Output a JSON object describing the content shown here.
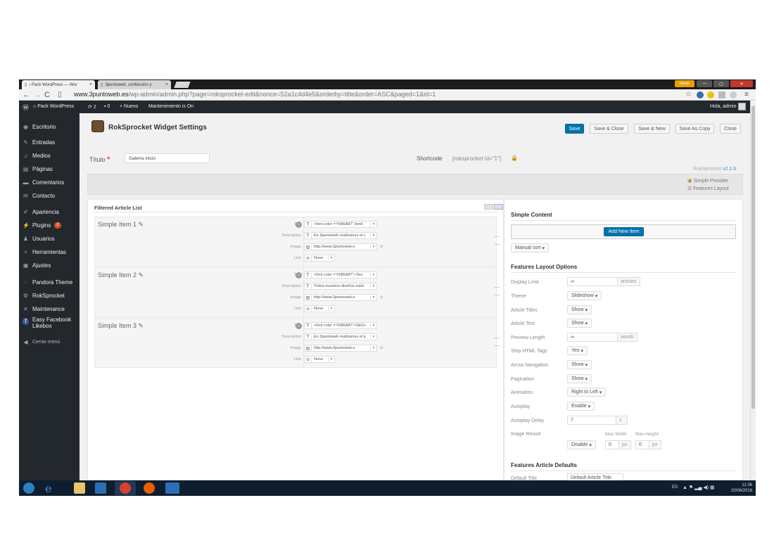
{
  "browser": {
    "tabs": [
      {
        "title": "‹ Pack WordPress — Wor"
      },
      {
        "title": "3puntoweb, confección y"
      }
    ],
    "window_user": "cesar",
    "url_domain": "www.3puntoweb.es",
    "url_path": "/wp-admin/admin.php?page=roksprocket-edit&nonce=52a1c4d4e5&orderby=title&order=ASC&paged=1&id=1"
  },
  "adminbar": {
    "site": "Pack WordPress",
    "updates": "2",
    "comments": "0",
    "new": "Nuevo",
    "maintenance": "Mantenimiento is On",
    "greeting": "Hola, admin"
  },
  "sidebar": {
    "items": [
      {
        "label": "Escritorio",
        "icon": "dashboard-icon"
      },
      {
        "label": "Entradas",
        "icon": "pin-icon"
      },
      {
        "label": "Medios",
        "icon": "media-icon"
      },
      {
        "label": "Páginas",
        "icon": "pages-icon"
      },
      {
        "label": "Comentarios",
        "icon": "comments-icon"
      },
      {
        "label": "Contacto",
        "icon": "mail-icon"
      },
      {
        "label": "Apariencia",
        "icon": "brush-icon"
      },
      {
        "label": "Plugins",
        "icon": "plugin-icon",
        "badge": "2"
      },
      {
        "label": "Usuarios",
        "icon": "users-icon"
      },
      {
        "label": "Herramientas",
        "icon": "wrench-icon"
      },
      {
        "label": "Ajustes",
        "icon": "settings-icon"
      },
      {
        "label": "Pandora Theme",
        "icon": "theme-icon"
      },
      {
        "label": "RokSprocket",
        "icon": "rocket-icon"
      },
      {
        "label": "Maintenance",
        "icon": "tools-icon"
      },
      {
        "label": "Easy Facebook Likebox",
        "icon": "facebook-icon"
      },
      {
        "label": "Cerrar menú",
        "icon": "collapse-icon"
      }
    ]
  },
  "header": {
    "title": "RokSprocket Widget Settings",
    "buttons": {
      "save": "Save",
      "save_close": "Save & Close",
      "save_new": "Save & New",
      "save_copy": "Save As Copy",
      "close": "Close"
    }
  },
  "form": {
    "title_label": "Título",
    "required_mark": "*",
    "title_value": "Galería inicio",
    "shortcode_label": "Shortcode",
    "shortcode_value": "[roksprocket id=\"1\"]",
    "version_prefix": "RokSprocket",
    "version": "v2.1.6",
    "provider": "Simple Provider",
    "layout": "Features Layout"
  },
  "filtered": {
    "heading": "Filtered Article List",
    "field_labels": {
      "title": "Title",
      "description": "Description",
      "image": "Image",
      "link": "Link"
    },
    "items": [
      {
        "name": "Simple Item 1",
        "title": "<font color =\"#086A87\" famil",
        "description": "En 3puntoweb realizamos el c",
        "image": "http://www.3puntoweb.e",
        "link": "None"
      },
      {
        "name": "Simple Item 2",
        "title": "<font color =\"#086A87\">Tecr",
        "description": "Todos nuestros diseños estár",
        "image": "http://www.3puntoweb.e",
        "link": "None"
      },
      {
        "name": "Simple Item 3",
        "title": "<font color =\"#086A87\">SEO<",
        "description": "En 3puntoweb realizamos el p",
        "image": "http://www.3puntoweb.e",
        "link": "None"
      }
    ]
  },
  "simple_content": {
    "heading": "Simple Content",
    "add_button": "Add New Item",
    "sort": "Manual sort"
  },
  "layout_options": {
    "heading": "Features Layout Options",
    "display_limit": {
      "label": "Display Limit",
      "value": "∞",
      "unit": "articles"
    },
    "theme": {
      "label": "Theme",
      "value": "Slideshow"
    },
    "article_titles": {
      "label": "Article Titles",
      "value": "Show"
    },
    "article_text": {
      "label": "Article Text",
      "value": "Show"
    },
    "preview_length": {
      "label": "Preview Length",
      "value": "∞",
      "unit": "words"
    },
    "strip_html": {
      "label": "Strip HTML Tags",
      "value": "Yes"
    },
    "arrow_nav": {
      "label": "Arrow Navigation",
      "value": "Show"
    },
    "pagination": {
      "label": "Pagination",
      "value": "Show"
    },
    "animation": {
      "label": "Animation",
      "value": "Right to Left"
    },
    "autoplay": {
      "label": "Autoplay",
      "value": "Enable"
    },
    "autoplay_delay": {
      "label": "Autoplay Delay",
      "value": "7",
      "unit": "s"
    },
    "image_resize": {
      "label": "Image Resize",
      "value": "Disable",
      "max_width_label": "Max Width",
      "max_height_label": "Max Height",
      "max_width": "0",
      "max_height": "0",
      "unit": "px"
    }
  },
  "article_defaults": {
    "heading": "Features Article Defaults",
    "default_title_label": "Default Title",
    "default_title_value": "Default Article Title"
  },
  "taskbar": {
    "lang": "ES",
    "time": "11:36",
    "date": "20/06/2016"
  }
}
